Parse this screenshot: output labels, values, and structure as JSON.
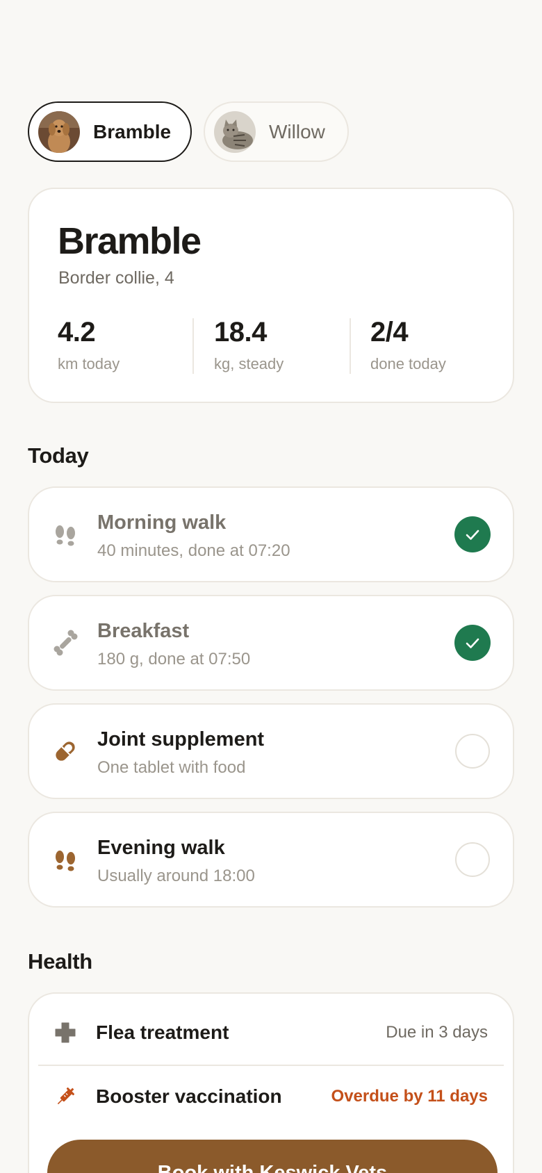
{
  "pets": [
    {
      "name": "Bramble",
      "active": true
    },
    {
      "name": "Willow",
      "active": false
    }
  ],
  "profile": {
    "name": "Bramble",
    "breed": "Border collie, 4",
    "stats": [
      {
        "value": "4.2",
        "label": "km today"
      },
      {
        "value": "18.4",
        "label": "kg, steady"
      },
      {
        "value": "2/4",
        "label": "done today"
      }
    ]
  },
  "today": {
    "title": "Today",
    "tasks": [
      {
        "title": "Morning walk",
        "subtitle": "40 minutes, done at 07:20",
        "done": true,
        "icon": "paw-prints-icon"
      },
      {
        "title": "Breakfast",
        "subtitle": "180 g, done at 07:50",
        "done": true,
        "icon": "bone-icon"
      },
      {
        "title": "Joint supplement",
        "subtitle": "One tablet with food",
        "done": false,
        "icon": "pill-icon"
      },
      {
        "title": "Evening walk",
        "subtitle": "Usually around 18:00",
        "done": false,
        "icon": "paw-prints-icon"
      }
    ]
  },
  "health": {
    "title": "Health",
    "items": [
      {
        "label": "Flea treatment",
        "status": "Due in 3 days",
        "icon": "plus-cross-icon"
      },
      {
        "label": "Booster vaccination",
        "status": "Overdue by 11 days",
        "icon": "syringe-icon"
      }
    ],
    "book_label": "Book with Keswick Vets"
  },
  "colors": {
    "background": "#f9f8f5",
    "done_green": "#1f7a4f",
    "brand_brown": "#8b5a2b",
    "overdue": "#c4501a"
  }
}
